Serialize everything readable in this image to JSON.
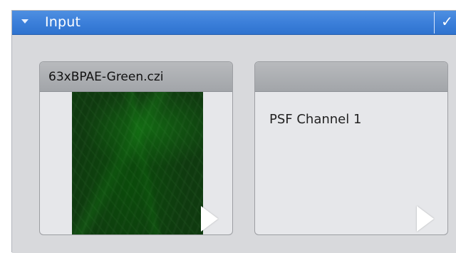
{
  "panel": {
    "title": "Input",
    "icons": {
      "collapse": "chevron-down-icon",
      "confirm": "check-icon"
    },
    "colors": {
      "header_blue": "#3a7ed9",
      "panel_bg": "#d9dadd"
    }
  },
  "inputs": [
    {
      "label": "63xBPAE-Green.czi",
      "preview": "green-microscopy-image",
      "action_icon": "play-icon"
    },
    {
      "label": "",
      "placeholder": "PSF Channel 1",
      "action_icon": "play-icon"
    }
  ]
}
